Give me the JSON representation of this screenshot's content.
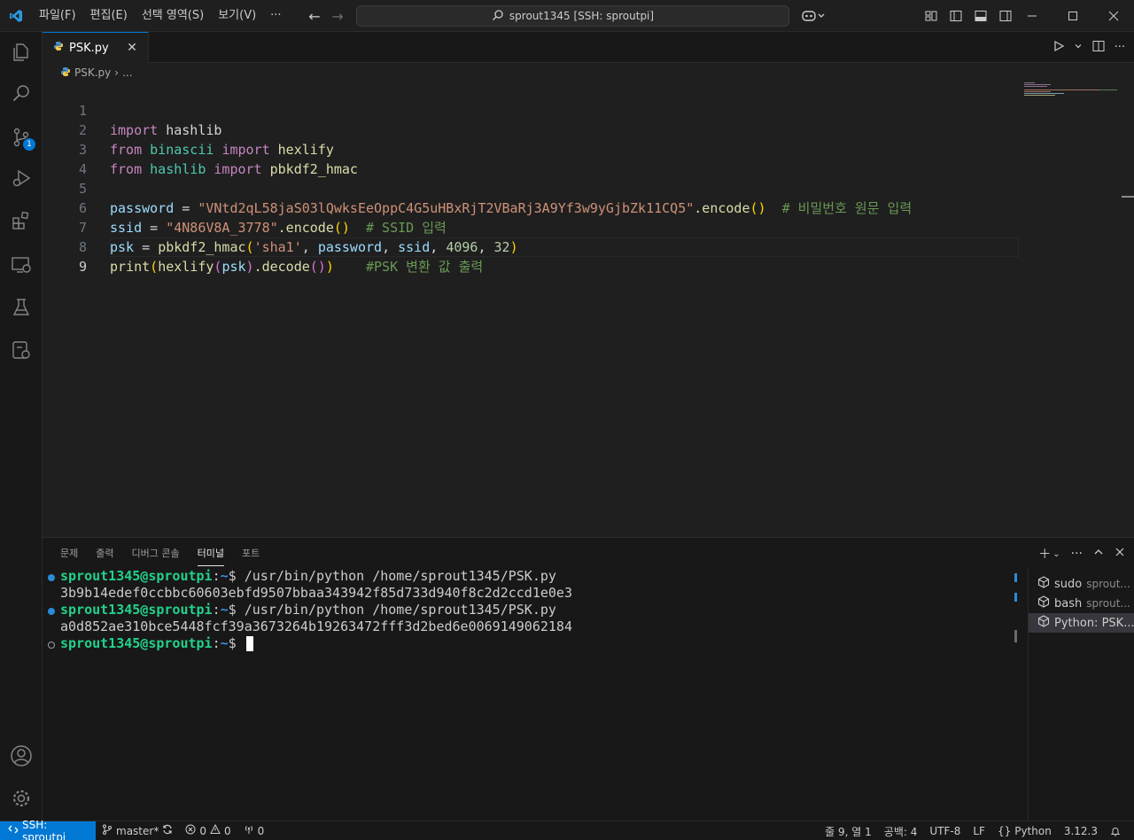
{
  "titlebar": {
    "menu": [
      {
        "label": "파일(F)"
      },
      {
        "label": "편집(E)"
      },
      {
        "label": "선택 영역(S)"
      },
      {
        "label": "보기(V)"
      },
      {
        "label": "···"
      }
    ],
    "command_center": "sprout1345 [SSH: sproutpi]"
  },
  "activitybar": {
    "source_control_badge": "1"
  },
  "tabs": [
    {
      "label": "PSK.py",
      "active": true
    }
  ],
  "breadcrumb": {
    "file": "PSK.py",
    "more": "..."
  },
  "editor": {
    "active_line": 9,
    "lines": [
      {
        "n": "1"
      },
      {
        "n": "2"
      },
      {
        "n": "3"
      },
      {
        "n": "4"
      },
      {
        "n": "5"
      },
      {
        "n": "6"
      },
      {
        "n": "7"
      },
      {
        "n": "8"
      },
      {
        "n": "9"
      }
    ],
    "code": {
      "l1": {
        "kw": "import",
        "mod": "hashlib"
      },
      "l2": {
        "kw1": "from",
        "mod1": "binascii",
        "kw2": "import",
        "fn": "hexlify"
      },
      "l3": {
        "kw1": "from",
        "mod1": "hashlib",
        "kw2": "import",
        "fn": "pbkdf2_hmac"
      },
      "l5": {
        "var": "password",
        "op": " = ",
        "str": "\"VNtd2qL58jaS03lQwksEeOppC4G5uHBxRjT2VBaRj3A9Yf3w9yGjbZk11CQ5\"",
        "method": ".encode",
        "paren": "()",
        "cmt": "# 비밀번호 원문 입력"
      },
      "l6": {
        "var": "ssid",
        "op": " = ",
        "str": "\"4N86V8A_3778\"",
        "method": ".encode",
        "paren": "()",
        "cmt": "# SSID 입력"
      },
      "l7": {
        "var": "psk",
        "op": " = ",
        "fn": "pbkdf2_hmac",
        "str": "'sha1'",
        "arg1": "password",
        "arg2": "ssid",
        "num1": "4096",
        "num2": "32"
      },
      "l8": {
        "fn": "print",
        "fn2": "hexlify",
        "arg": "psk",
        "method": ".decode",
        "cmt": "#PSK 변환 값 출력"
      }
    }
  },
  "panel": {
    "tabs": [
      {
        "label": "문제"
      },
      {
        "label": "출력"
      },
      {
        "label": "디버그 콘솔"
      },
      {
        "label": "터미널",
        "active": true
      },
      {
        "label": "포트"
      }
    ],
    "terminal": {
      "user": "sprout1345@sproutpi",
      "path": "~",
      "lines": [
        {
          "type": "cmd",
          "cmd": "$ /usr/bin/python /home/sprout1345/PSK.py"
        },
        {
          "type": "out",
          "text": "3b9b14edef0ccbbc60603ebfd9507bbaa343942f85d733d940f8c2d2ccd1e0e3"
        },
        {
          "type": "cmd",
          "cmd": "$ /usr/bin/python /home/sprout1345/PSK.py"
        },
        {
          "type": "out",
          "text": "a0d852ae310bce5448fcf39a3673264b19263472fff3d2bed6e0069149062184"
        },
        {
          "type": "prompt",
          "cmd": "$ "
        }
      ]
    },
    "terminal_list": [
      {
        "name": "sudo",
        "sub": "sprout..."
      },
      {
        "name": "bash",
        "sub": "sprout..."
      },
      {
        "name": "Python: PSK...",
        "sub": "",
        "active": true
      }
    ]
  },
  "statusbar": {
    "remote": "SSH: sproutpi",
    "branch": "master*",
    "errors": "0",
    "warnings": "0",
    "ports": "0",
    "position": "줄 9, 열 1",
    "spaces": "공백: 4",
    "encoding": "UTF-8",
    "eol": "LF",
    "language": "Python",
    "version": "3.12.3"
  },
  "colors": {
    "accent": "#0078d4",
    "background": "#1f1f1f"
  }
}
